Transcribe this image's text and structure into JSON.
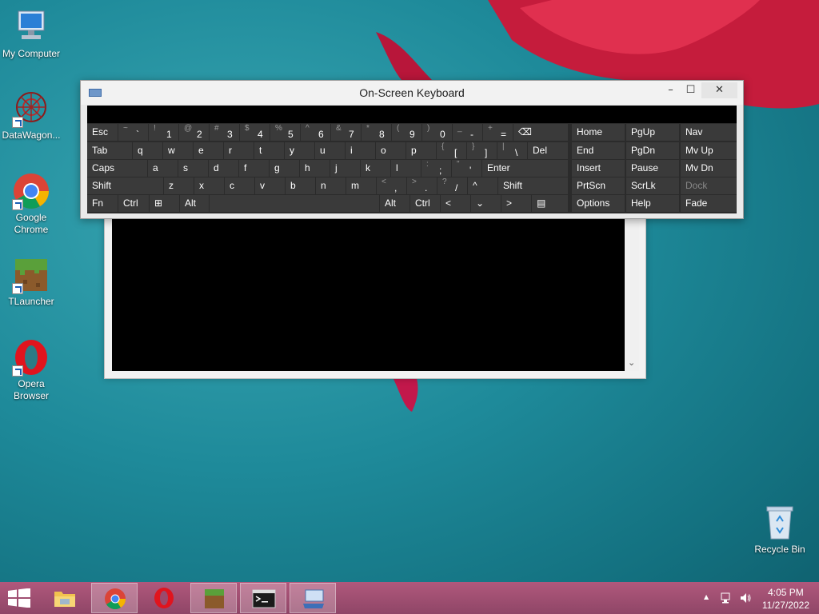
{
  "desktop": {
    "icons": [
      {
        "name": "desktop-icon-my-computer",
        "label": "My Computer"
      },
      {
        "name": "desktop-icon-datawagon",
        "label": "DataWagon..."
      },
      {
        "name": "desktop-icon-google-chrome",
        "label": "Google Chrome"
      },
      {
        "name": "desktop-icon-tlauncher",
        "label": "TLauncher"
      },
      {
        "name": "desktop-icon-opera",
        "label": "Opera Browser"
      },
      {
        "name": "desktop-icon-recycle-bin",
        "label": "Recycle Bin"
      }
    ]
  },
  "osk": {
    "title": "On-Screen Keyboard",
    "minimize": "–",
    "maximize": "☐",
    "close": "✕",
    "rows": [
      [
        {
          "m": "Esc"
        },
        {
          "s": "~",
          "b": "`"
        },
        {
          "s": "!",
          "b": "1"
        },
        {
          "s": "@",
          "b": "2"
        },
        {
          "s": "#",
          "b": "3"
        },
        {
          "s": "$",
          "b": "4"
        },
        {
          "s": "%",
          "b": "5"
        },
        {
          "s": "^",
          "b": "6"
        },
        {
          "s": "&",
          "b": "7"
        },
        {
          "s": "*",
          "b": "8"
        },
        {
          "s": "(",
          "b": "9"
        },
        {
          "s": ")",
          "b": "0"
        },
        {
          "s": "_",
          "b": "-"
        },
        {
          "s": "+",
          "b": "="
        },
        {
          "m": "⌫"
        }
      ],
      [
        {
          "m": "Tab"
        },
        {
          "m": "q"
        },
        {
          "m": "w"
        },
        {
          "m": "e"
        },
        {
          "m": "r"
        },
        {
          "m": "t"
        },
        {
          "m": "y"
        },
        {
          "m": "u"
        },
        {
          "m": "i"
        },
        {
          "m": "o"
        },
        {
          "m": "p"
        },
        {
          "s": "{",
          "b": "["
        },
        {
          "s": "}",
          "b": "]"
        },
        {
          "s": "|",
          "b": "\\"
        },
        {
          "m": "Del"
        }
      ],
      [
        {
          "m": "Caps"
        },
        {
          "m": "a"
        },
        {
          "m": "s"
        },
        {
          "m": "d"
        },
        {
          "m": "f"
        },
        {
          "m": "g"
        },
        {
          "m": "h"
        },
        {
          "m": "j"
        },
        {
          "m": "k"
        },
        {
          "m": "l"
        },
        {
          "s": ":",
          "b": ";"
        },
        {
          "s": "\"",
          "b": "'"
        },
        {
          "m": "Enter"
        }
      ],
      [
        {
          "m": "Shift"
        },
        {
          "m": "z"
        },
        {
          "m": "x"
        },
        {
          "m": "c"
        },
        {
          "m": "v"
        },
        {
          "m": "b"
        },
        {
          "m": "n"
        },
        {
          "m": "m"
        },
        {
          "s": "<",
          "b": ","
        },
        {
          "s": ">",
          "b": "."
        },
        {
          "s": "?",
          "b": "/"
        },
        {
          "m": "^"
        },
        {
          "m": "Shift"
        }
      ],
      [
        {
          "m": "Fn"
        },
        {
          "m": "Ctrl"
        },
        {
          "m": "⊞"
        },
        {
          "m": "Alt"
        },
        {
          "m": ""
        },
        {
          "m": "Alt"
        },
        {
          "m": "Ctrl"
        },
        {
          "m": "<"
        },
        {
          "m": "⌄"
        },
        {
          "m": ">"
        },
        {
          "m": "▤"
        }
      ]
    ],
    "nav": [
      [
        "Home",
        "PgUp",
        "Nav"
      ],
      [
        "End",
        "PgDn",
        "Mv Up"
      ],
      [
        "Insert",
        "Pause",
        "Mv Dn"
      ],
      [
        "PrtScn",
        "ScrLk",
        "Dock"
      ],
      [
        "Options",
        "Help",
        "Fade"
      ]
    ]
  },
  "console": {
    "scroll_arrow": "⌄"
  },
  "taskbar": {
    "items": [
      {
        "name": "taskbar-file-explorer"
      },
      {
        "name": "taskbar-chrome"
      },
      {
        "name": "taskbar-opera"
      },
      {
        "name": "taskbar-tlauncher"
      },
      {
        "name": "taskbar-command-prompt"
      },
      {
        "name": "taskbar-on-screen-keyboard"
      }
    ],
    "tray": {
      "time": "4:05 PM",
      "date": "11/27/2022",
      "show_hidden": "▲"
    }
  }
}
